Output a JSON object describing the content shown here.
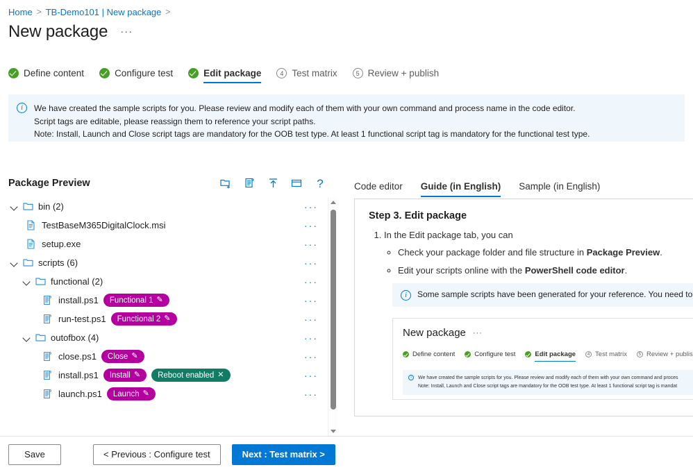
{
  "breadcrumb": {
    "items": [
      {
        "label": "Home"
      },
      {
        "label": "TB-Demo101 | New package"
      }
    ],
    "separator": ">"
  },
  "header": {
    "title": "New package",
    "more_label": "···"
  },
  "wizard": {
    "steps": [
      {
        "label": "Define content",
        "state": "complete",
        "marker": "check"
      },
      {
        "label": "Configure test",
        "state": "complete",
        "marker": "check"
      },
      {
        "label": "Edit package",
        "state": "active",
        "marker": "check"
      },
      {
        "label": "Test matrix",
        "state": "pending",
        "marker": "4"
      },
      {
        "label": "Review + publish",
        "state": "pending",
        "marker": "5"
      }
    ]
  },
  "banner": {
    "icon": "info-icon",
    "line1": "We have created the sample scripts for you. Please review and modify each of them with your own command and process name in the code editor.",
    "line2": "Script tags are editable, please reassign them to reference your script paths.",
    "line3": "Note: Install, Launch and Close script tags are mandatory for the OOB test type. At least 1 functional script tag is mandatory for the functional test type."
  },
  "package_preview": {
    "title": "Package Preview",
    "tools": [
      {
        "name": "new-folder-icon",
        "label": "New folder"
      },
      {
        "name": "new-script-icon",
        "label": "New script"
      },
      {
        "name": "upload-icon",
        "label": "Upload"
      },
      {
        "name": "rename-window-icon",
        "label": "Rename"
      },
      {
        "name": "help-icon",
        "label": "?"
      }
    ],
    "row_menu_label": "···",
    "tree": [
      {
        "indent": 0,
        "type": "folder",
        "expanded": true,
        "label": "bin (2)",
        "tags": []
      },
      {
        "indent": 1,
        "type": "file",
        "expanded": false,
        "label": "TestBaseM365DigitalClock.msi",
        "tags": []
      },
      {
        "indent": 1,
        "type": "file",
        "expanded": false,
        "label": "setup.exe",
        "tags": []
      },
      {
        "indent": 0,
        "type": "folder",
        "expanded": true,
        "label": "scripts (6)",
        "tags": []
      },
      {
        "indent": 1,
        "type": "folder",
        "expanded": true,
        "label": "functional (2)",
        "tags": []
      },
      {
        "indent": 2,
        "type": "script",
        "expanded": false,
        "label": "install.ps1",
        "tags": [
          {
            "text": "Functional 1",
            "color": "magenta",
            "action": "edit"
          }
        ]
      },
      {
        "indent": 2,
        "type": "script",
        "expanded": false,
        "label": "run-test.ps1",
        "tags": [
          {
            "text": "Functional 2",
            "color": "magenta",
            "action": "edit"
          }
        ]
      },
      {
        "indent": 1,
        "type": "folder",
        "expanded": true,
        "label": "outofbox (4)",
        "tags": []
      },
      {
        "indent": 2,
        "type": "script",
        "expanded": false,
        "label": "close.ps1",
        "tags": [
          {
            "text": "Close",
            "color": "magenta",
            "action": "edit"
          }
        ]
      },
      {
        "indent": 2,
        "type": "script",
        "expanded": false,
        "label": "install.ps1",
        "tags": [
          {
            "text": "Install",
            "color": "magenta",
            "action": "edit"
          },
          {
            "text": "Reboot enabled",
            "color": "teal",
            "action": "remove"
          }
        ]
      },
      {
        "indent": 2,
        "type": "script",
        "expanded": false,
        "label": "launch.ps1",
        "tags": [
          {
            "text": "Launch",
            "color": "magenta",
            "action": "edit"
          }
        ]
      }
    ]
  },
  "right_panel": {
    "tabs": [
      {
        "label": "Code editor",
        "active": false
      },
      {
        "label": "Guide (in English)",
        "active": true
      },
      {
        "label": "Sample (in English)",
        "active": false
      }
    ],
    "guide": {
      "heading": "Step 3. Edit package",
      "item1": "In the Edit package tab, you can",
      "bullet1_pre": "Check your package folder and file structure in ",
      "bullet1_bold": "Package Preview",
      "bullet1_post": ".",
      "bullet2_pre": "Edit your scripts online with the ",
      "bullet2_bold": "PowerShell code editor",
      "bullet2_post": ".",
      "note": "Some sample scripts have been generated for your reference. You need to review",
      "mini": {
        "title": "New package",
        "more_label": "···",
        "steps": [
          {
            "label": "Define content",
            "state": "complete",
            "marker": "check"
          },
          {
            "label": "Configure test",
            "state": "complete",
            "marker": "check"
          },
          {
            "label": "Edit package",
            "state": "active",
            "marker": "check"
          },
          {
            "label": "Test matrix",
            "state": "pending",
            "marker": "4"
          },
          {
            "label": "Review + publish",
            "state": "pending",
            "marker": "5"
          }
        ],
        "banner_line1": "We have created the sample scripts for you. Please review and modify each of them with your own command and proces",
        "banner_line2": "Note: Install, Launch and Close script tags are mandatory for the OOB test type. At least 1 functional script tag is mandat"
      }
    }
  },
  "footer": {
    "save": "Save",
    "previous": "< Previous : Configure test",
    "next": "Next : Test matrix >"
  },
  "colors": {
    "accent": "#0078d4",
    "success": "#47a025",
    "tag_magenta": "#b4009e",
    "tag_teal": "#107c64",
    "banner_bg": "#eff6fc"
  }
}
